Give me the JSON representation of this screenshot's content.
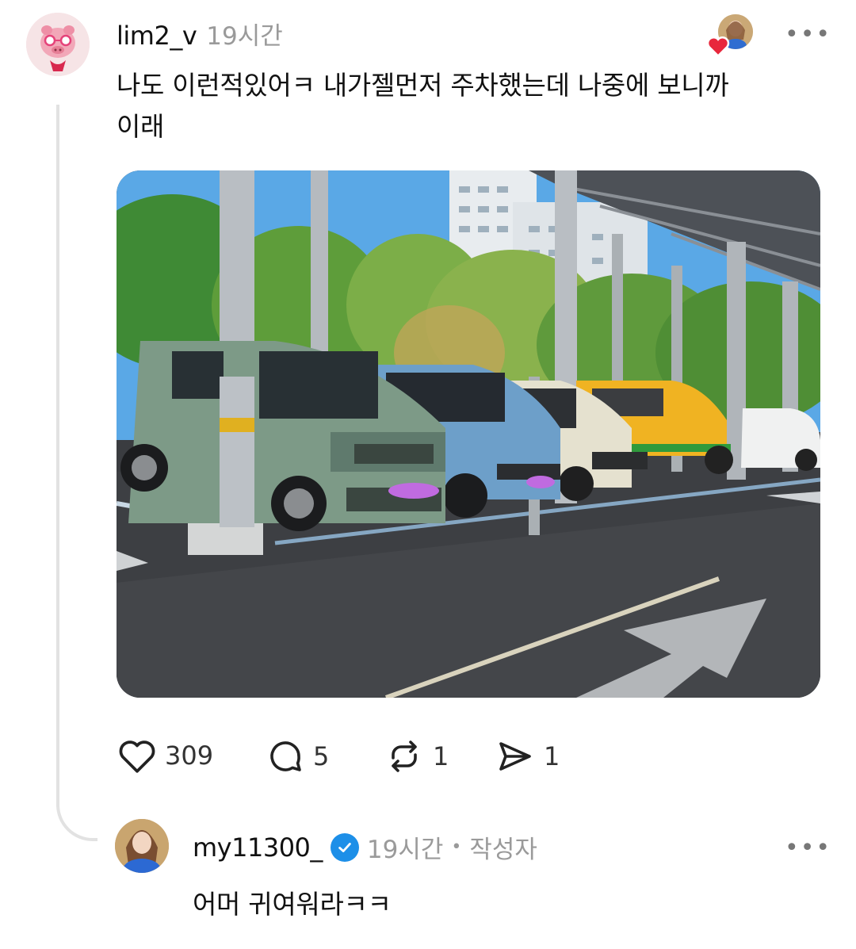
{
  "post": {
    "username": "lim2_v",
    "time": "19시간",
    "text_line1": "나도 이런적있어ㅋ 내가젤먼저 주차했는데 나중에 보니까",
    "text_line2": "이래",
    "more_label": "•••",
    "stats": {
      "likes": "309",
      "comments": "5",
      "reposts": "1",
      "shares": "1"
    }
  },
  "reply": {
    "username": "my11300_",
    "time": "19시간",
    "separator": "•",
    "author_tag": "작성자",
    "text": "어머 귀여워라ㅋㅋ",
    "more_label": "•••"
  },
  "colors": {
    "heart": "#e8273c",
    "verified": "#1d8fe8",
    "muted": "#9a9a9a"
  },
  "icons": [
    "pig-avatar",
    "heart-reaction-icon",
    "heart-icon",
    "comment-icon",
    "repost-icon",
    "share-icon",
    "verified-icon"
  ]
}
